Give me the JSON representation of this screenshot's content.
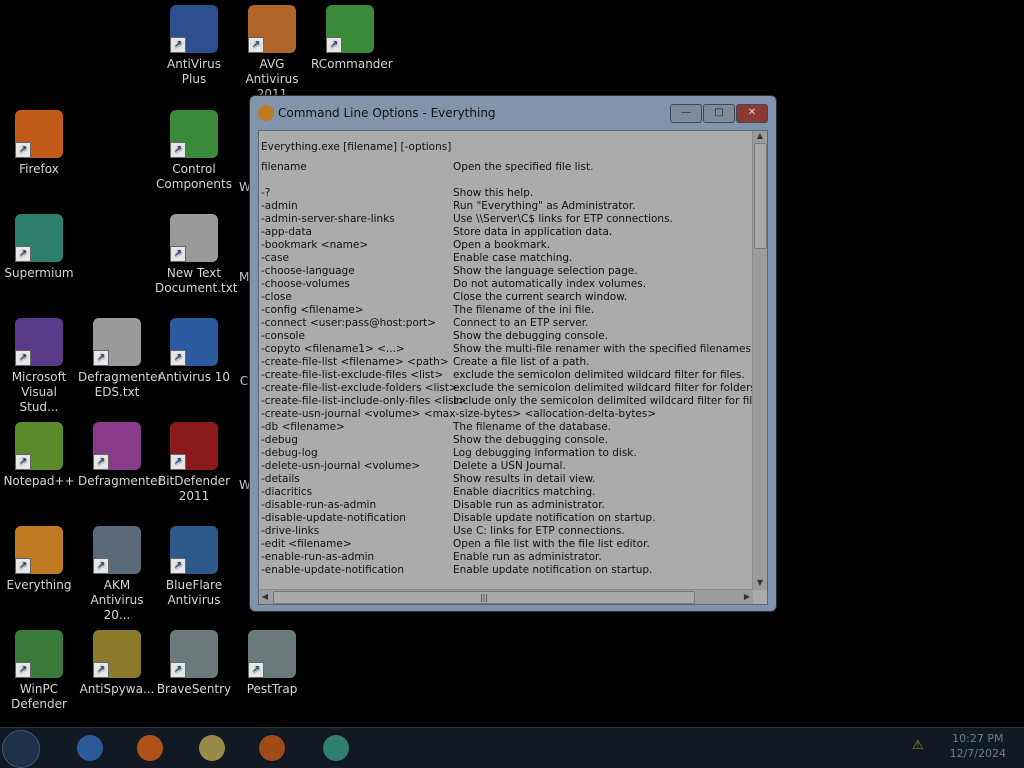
{
  "desktop": {
    "icons": [
      {
        "label": "AntiVirus Plus",
        "icon": "shield-icon",
        "color": "#2b4f8f"
      },
      {
        "label": "AVG Antivirus 2011",
        "icon": "avg-icon",
        "color": "#b0662a"
      },
      {
        "label": "RCommander",
        "icon": "check-icon",
        "color": "#3a8a3a"
      },
      {
        "label": "Firefox",
        "icon": "firefox-icon",
        "color": "#c25a1a"
      },
      {
        "label": "Control Components",
        "icon": "check-icon",
        "color": "#3a8a3a"
      },
      {
        "label": "Supermium",
        "icon": "supermium-icon",
        "color": "#2f7f6f"
      },
      {
        "label": "New Text Document.txt",
        "icon": "text-file-icon",
        "color": "#9a9a9a"
      },
      {
        "label": "Microsoft Visual Stud...",
        "icon": "visual-studio-icon",
        "color": "#5b3a8a"
      },
      {
        "label": "Defragmenter EDS.txt",
        "icon": "text-file-icon",
        "color": "#9a9a9a"
      },
      {
        "label": "Antivirus 10",
        "icon": "windows-icon",
        "color": "#2b5aa0"
      },
      {
        "label": "Notepad++",
        "icon": "notepad-icon",
        "color": "#5a8a2a"
      },
      {
        "label": "Defragmenter",
        "icon": "defrag-icon",
        "color": "#8a3a8a"
      },
      {
        "label": "BitDefender 2011",
        "icon": "bitdefender-icon",
        "color": "#8a1a1a"
      },
      {
        "label": "Everything",
        "icon": "everything-icon",
        "color": "#c07a22"
      },
      {
        "label": "AKM Antivirus 20...",
        "icon": "shield-icon",
        "color": "#5a6a7a"
      },
      {
        "label": "BlueFlare Antivirus",
        "icon": "shield-icon",
        "color": "#2b5a8a"
      },
      {
        "label": "WinPC Defender",
        "icon": "shield-icon",
        "color": "#3a7a3a"
      },
      {
        "label": "AntiSpywa...",
        "icon": "antispy-icon",
        "color": "#8a7a2a"
      },
      {
        "label": "BraveSentry",
        "icon": "app-icon",
        "color": "#6a7a7a"
      },
      {
        "label": "PestTrap",
        "icon": "app-icon",
        "color": "#6a7a7a"
      }
    ],
    "partial_labels": [
      "W",
      "M",
      "C",
      "W"
    ]
  },
  "window": {
    "title": "Command Line Options - Everything",
    "buttons": {
      "minimize": "—",
      "maximize": "□",
      "close": "✕"
    },
    "usage": "Everything.exe [filename] [-options]",
    "rows": [
      {
        "name": "filename",
        "desc": "Open the specified file list."
      },
      {
        "name": "-?",
        "desc": "Show this help."
      },
      {
        "name": "-admin",
        "desc": "Run \"Everything\" as Administrator."
      },
      {
        "name": "-admin-server-share-links",
        "desc": "Use \\\\Server\\C$ links for ETP connections."
      },
      {
        "name": "-app-data",
        "desc": "Store data in application data."
      },
      {
        "name": "-bookmark <name>",
        "desc": "Open a bookmark."
      },
      {
        "name": "-case",
        "desc": "Enable case matching."
      },
      {
        "name": "-choose-language",
        "desc": "Show the language selection page."
      },
      {
        "name": "-choose-volumes",
        "desc": "Do not automatically index volumes."
      },
      {
        "name": "-close",
        "desc": "Close the current search window."
      },
      {
        "name": "-config <filename>",
        "desc": "The filename of the ini file."
      },
      {
        "name": "-connect <user:pass@host:port>",
        "desc": "Connect to an ETP server."
      },
      {
        "name": "-console",
        "desc": "Show the debugging console."
      },
      {
        "name": "-copyto <filename1> <...>",
        "desc": "Show the multi-file renamer with the specified filenames."
      },
      {
        "name": "-create-file-list <filename> <path>",
        "desc": "Create a file list of a path."
      },
      {
        "name": "-create-file-list-exclude-files <list>",
        "desc": "exclude the semicolon delimited wildcard filter for files."
      },
      {
        "name": "-create-file-list-exclude-folders <list>",
        "desc": "exclude the semicolon delimited wildcard filter for folders."
      },
      {
        "name": "-create-file-list-include-only-files <list>",
        "desc": "include only the semicolon delimited wildcard filter for files."
      },
      {
        "name": "-create-usn-journal <volume> <max-size-bytes> <allocation-delta-bytes>",
        "desc": ""
      },
      {
        "name": "-db <filename>",
        "desc": "The filename of the database."
      },
      {
        "name": "-debug",
        "desc": "Show the debugging console."
      },
      {
        "name": "-debug-log",
        "desc": "Log debugging information to disk."
      },
      {
        "name": "-delete-usn-journal <volume>",
        "desc": "Delete a USN Journal."
      },
      {
        "name": "-details",
        "desc": "Show results in detail view."
      },
      {
        "name": "-diacritics",
        "desc": "Enable diacritics matching."
      },
      {
        "name": "-disable-run-as-admin",
        "desc": "Disable run as administrator."
      },
      {
        "name": "-disable-update-notification",
        "desc": "Disable update notification on startup."
      },
      {
        "name": "-drive-links",
        "desc": "Use C: links for ETP connections."
      },
      {
        "name": "-edit <filename>",
        "desc": "Open a file list with the file list editor."
      },
      {
        "name": "-enable-run-as-admin",
        "desc": "Enable run as administrator."
      },
      {
        "name": "-enable-update-notification",
        "desc": "Enable update notification on startup."
      }
    ]
  },
  "taskbar": {
    "items": [
      {
        "icon": "internet-explorer-icon",
        "color": "#2a5a9a"
      },
      {
        "icon": "firefox-icon",
        "color": "#b0501a"
      },
      {
        "icon": "folder-icon",
        "color": "#9a8a4a"
      },
      {
        "icon": "media-player-icon",
        "color": "#a04a1a"
      },
      {
        "icon": "supermium-icon",
        "color": "#2f7f6f"
      }
    ],
    "time": "10:27 PM",
    "date": "12/7/2024"
  }
}
